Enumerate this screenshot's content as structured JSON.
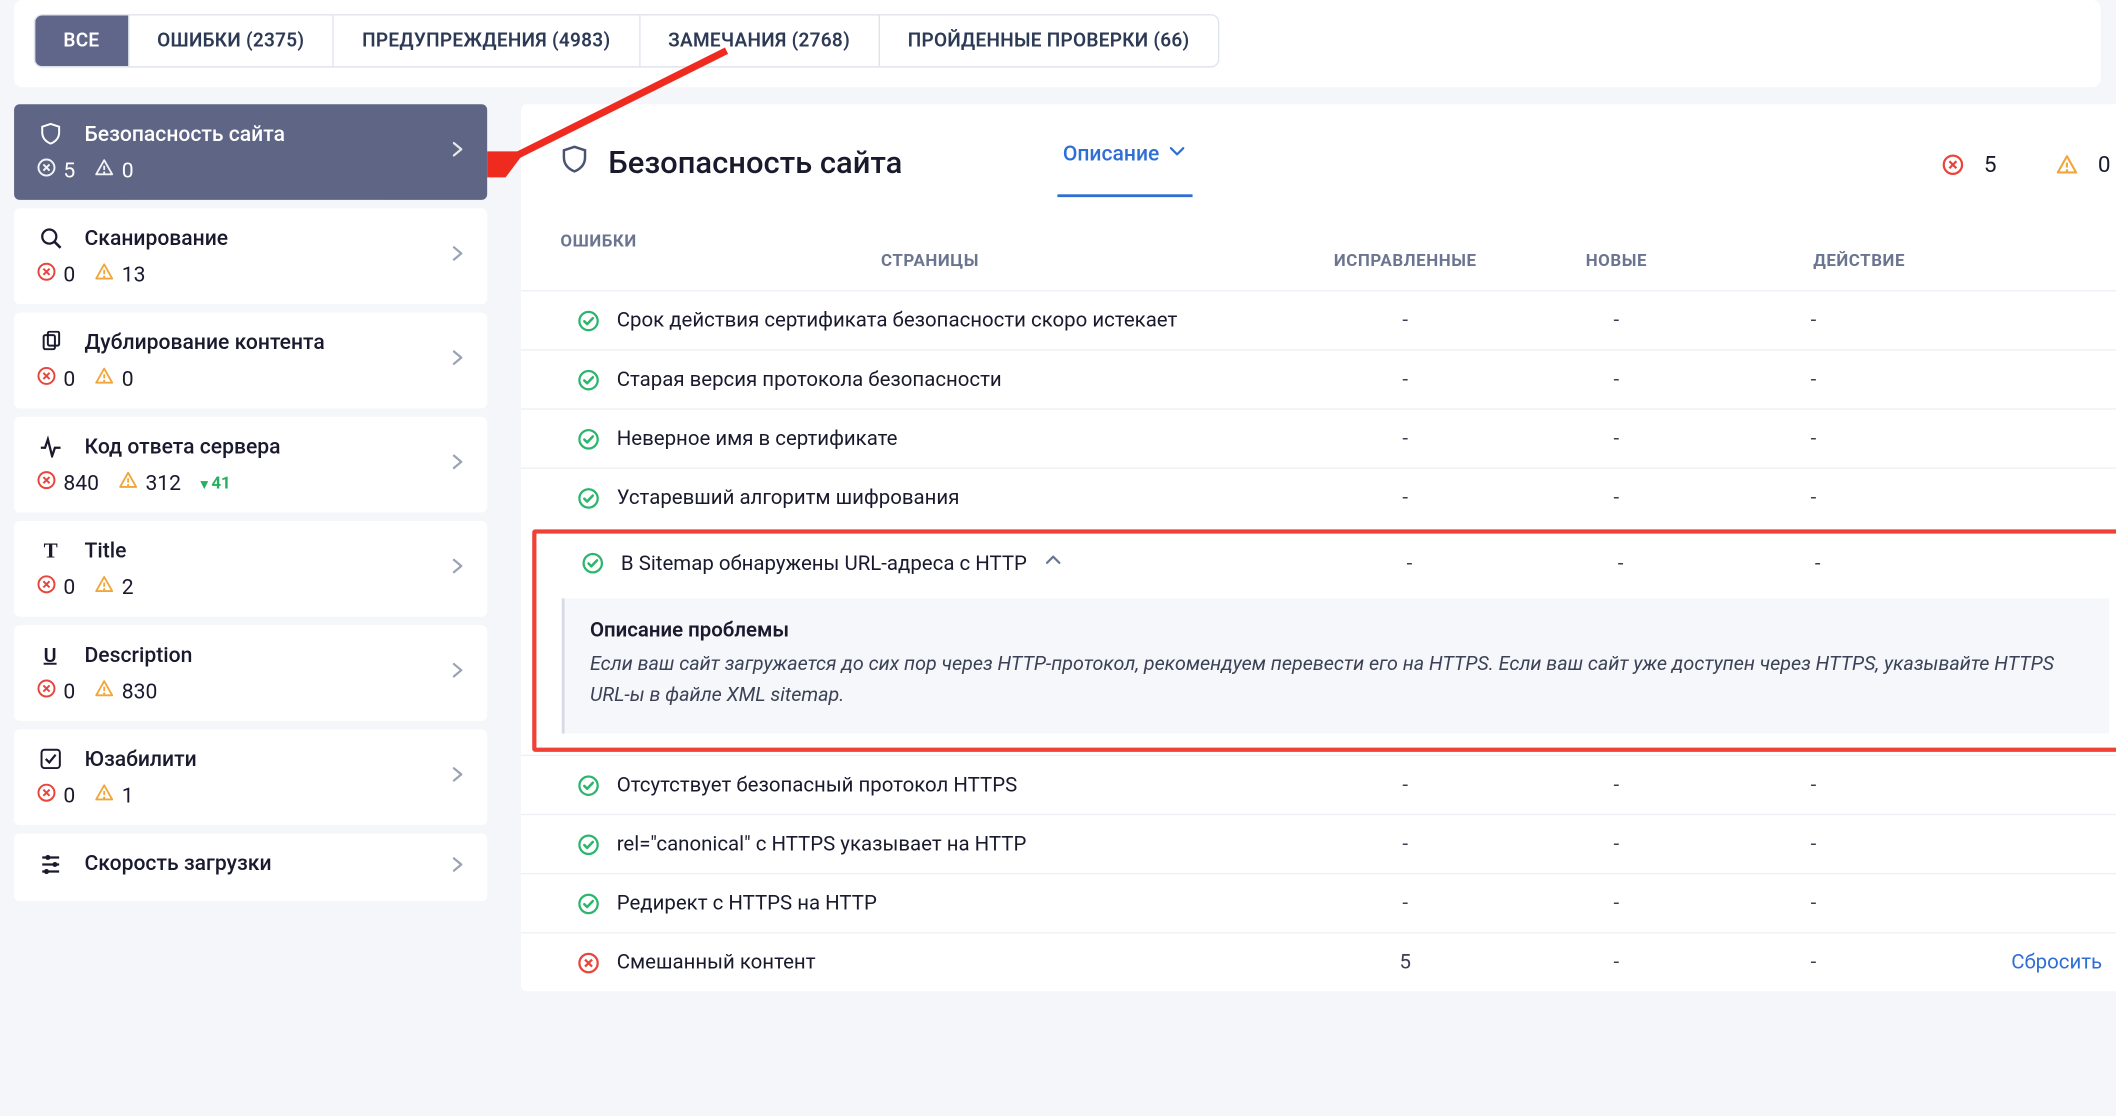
{
  "top_tabs": {
    "all": "ВСЕ",
    "errors": "ОШИБКИ (2375)",
    "warnings": "ПРЕДУПРЕЖДЕНИЯ (4983)",
    "notes": "ЗАМЕЧАНИЯ (2768)",
    "passed": "ПРОЙДЕННЫЕ ПРОВЕРКИ (66)"
  },
  "sidebar": [
    {
      "label": "Безопасность сайта",
      "errors": "5",
      "warnings": "0"
    },
    {
      "label": "Сканирование",
      "errors": "0",
      "warnings": "13"
    },
    {
      "label": "Дублирование контента",
      "errors": "0",
      "warnings": "0"
    },
    {
      "label": "Код ответа сервера",
      "errors": "840",
      "warnings": "312",
      "delta": "41"
    },
    {
      "label": "Title",
      "errors": "0",
      "warnings": "2"
    },
    {
      "label": "Description",
      "errors": "0",
      "warnings": "830"
    },
    {
      "label": "Юзабилити",
      "errors": "0",
      "warnings": "1"
    },
    {
      "label": "Скорость загрузки"
    }
  ],
  "main": {
    "title": "Безопасность сайта",
    "tab_description": "Описание",
    "head_errors": "5",
    "head_warnings": "0"
  },
  "columns": {
    "errors": "ОШИБКИ",
    "pages": "СТРАНИЦЫ",
    "fixed": "ИСПРАВЛЕННЫЕ",
    "new": "НОВЫЕ",
    "action": "ДЕЙСТВИЕ"
  },
  "rows": [
    {
      "status": "ok",
      "name": "Срок действия сертификата безопасности скоро истекает",
      "pages": "-",
      "fixed": "-",
      "new": "-",
      "action": ""
    },
    {
      "status": "ok",
      "name": "Старая версия протокола безопасности",
      "pages": "-",
      "fixed": "-",
      "new": "-",
      "action": ""
    },
    {
      "status": "ok",
      "name": "Неверное имя в сертификате",
      "pages": "-",
      "fixed": "-",
      "new": "-",
      "action": ""
    },
    {
      "status": "ok",
      "name": "Устаревший алгоритм шифрования",
      "pages": "-",
      "fixed": "-",
      "new": "-",
      "action": ""
    },
    {
      "status": "ok",
      "name": "В Sitemap обнаружены URL-адреса с HTTP",
      "pages": "-",
      "fixed": "-",
      "new": "-",
      "action": "",
      "expanded": true
    },
    {
      "status": "ok",
      "name": "Отсутствует безопасный протокол HTTPS",
      "pages": "-",
      "fixed": "-",
      "new": "-",
      "action": ""
    },
    {
      "status": "ok",
      "name": "rel=\"canonical\" с HTTPS указывает на HTTP",
      "pages": "-",
      "fixed": "-",
      "new": "-",
      "action": ""
    },
    {
      "status": "ok",
      "name": "Редирект с HTTPS на HTTP",
      "pages": "-",
      "fixed": "-",
      "new": "-",
      "action": ""
    },
    {
      "status": "err",
      "name": "Смешанный контент",
      "pages": "5",
      "fixed": "-",
      "new": "-",
      "action": "Сбросить"
    }
  ],
  "desc": {
    "title": "Описание проблемы",
    "body": "Если ваш сайт загружается до сих пор через HTTP-протокол, рекомендуем перевести его на HTTPS. Если ваш сайт уже доступен через HTTPS, указывайте HTTPS URL-ы в файле XML sitemap."
  }
}
